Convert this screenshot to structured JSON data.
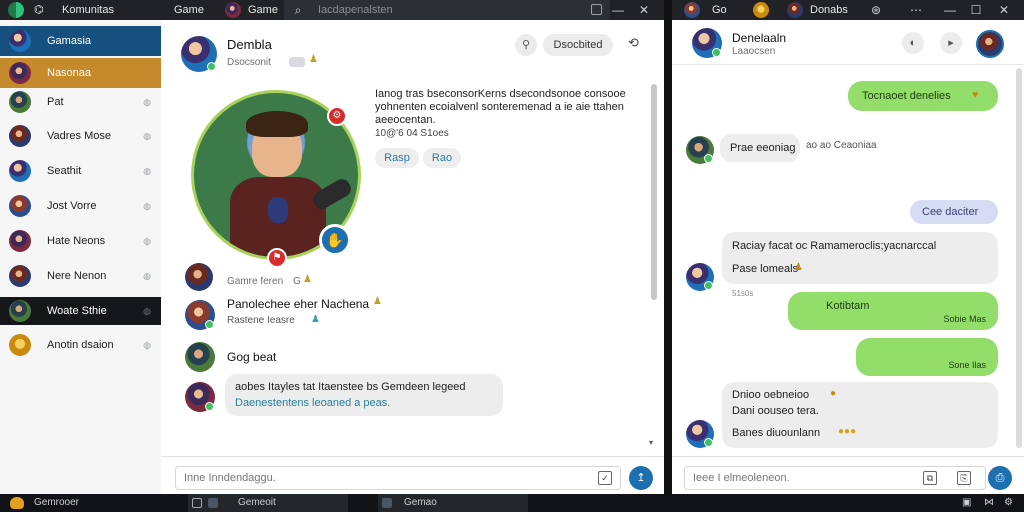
{
  "app": {
    "title": "Komunitas",
    "nav_game": "Game",
    "nav_game2": "Game",
    "search_placeholder": "Iacdapenalsten"
  },
  "right_window": {
    "tab_label": "Go",
    "tab_label2": "Donabs"
  },
  "sidebar": {
    "items": [
      {
        "label": "Gamasia"
      },
      {
        "label": "Nasonaa"
      },
      {
        "label": "Pat"
      },
      {
        "label": "Vadres Mose"
      },
      {
        "label": "Seathit"
      },
      {
        "label": "Jost Vorre"
      },
      {
        "label": "Hate Neons"
      },
      {
        "label": "Nere Nenon"
      },
      {
        "label": "Woate Sthie"
      },
      {
        "label": "Anotin dsaion"
      }
    ]
  },
  "main": {
    "header": {
      "name": "Dembla",
      "status": "Dsocsonit",
      "status_badge": "—",
      "action_button": "Dsocbited"
    },
    "profile": {
      "description": "Ianog tras bseconsorKerns dsecondsonoe consooe yohnenten ecoialvenl sonteremenad a ie aie ttahen aeeocentan.",
      "meta": "10@'6 04 S1oes",
      "tag1": "Rasp",
      "tag2": "Rao"
    },
    "messages": [
      {
        "name": "Gamre feren",
        "extra": "G"
      },
      {
        "name": "Panolechee eher Nachena",
        "sub": "Rastene Ieasre"
      },
      {
        "name": "Gog beat"
      },
      {
        "text_line1": "aobes Itayles tat  Itaenstee bs Gemdeen legeed",
        "text_line2": "Daenestentens leoaned a peas."
      }
    ],
    "input_placeholder": "Inne Inndendaggu."
  },
  "chat": {
    "header": {
      "name": "Denelaaln",
      "status": "Laaocsen"
    },
    "messages": [
      {
        "side": "out",
        "text": "Tocnaoet denelies"
      },
      {
        "side": "in",
        "text": "Prae eeoniag",
        "aside": "ao ao Ceaoniaa"
      },
      {
        "side": "blue",
        "text": "Cee daciter"
      },
      {
        "side": "in",
        "line1": "Raciay facat oc Ramameroclis;yacnarccal",
        "line2": "Pase lomeals"
      },
      {
        "side": "meta",
        "text": "51s0s"
      },
      {
        "side": "out",
        "text": "Kotibtam",
        "time": "Sobie Mas"
      },
      {
        "side": "out",
        "text": "",
        "time": "Sone Ilas"
      },
      {
        "side": "in",
        "line1": "Dnioo oebneioo",
        "line2": "Dani oouseo tera.",
        "line3": "Banes diuounlann"
      }
    ],
    "input_placeholder": "Ieee I elmeoleneon."
  },
  "taskbar": {
    "start_label": "Gemrooer",
    "item1": "Gemeoit",
    "item2": "Gemao"
  },
  "colors": {
    "sidebar_active": "#15507e",
    "sidebar_selected": "#c48a2c",
    "sidebar_dark": "#15171b",
    "bubble_out": "#93de6b",
    "accent_blue": "#1e6fb0"
  }
}
